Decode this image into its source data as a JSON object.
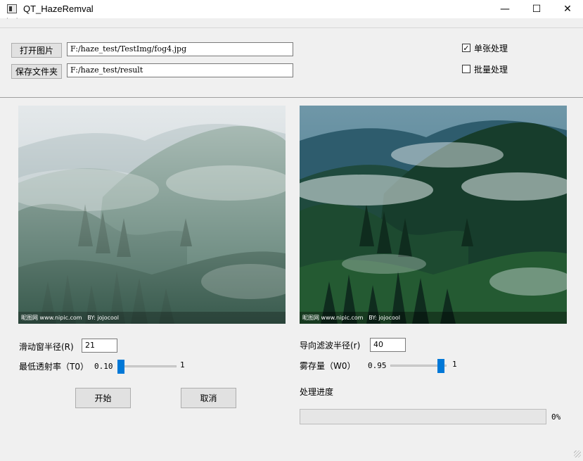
{
  "window": {
    "title": "QT_HazeRemval",
    "minimize_glyph": "—",
    "maximize_glyph": "☐",
    "close_glyph": "✕"
  },
  "menubar": {
    "handle_text": "· ·"
  },
  "file": {
    "open_label": "打开图片",
    "open_path": "F:/haze_test/TestImg/fog4.jpg",
    "save_label": "保存文件夹",
    "save_path": "F:/haze_test/result"
  },
  "mode": {
    "single_label": "单张处理",
    "single_checked": true,
    "batch_label": "批量处理",
    "batch_checked": false,
    "check_glyph": "✓"
  },
  "images": {
    "input_watermark_left": "昵图网 www.nipic.com",
    "input_watermark_mid": "BY: jojocool",
    "output_watermark_left": "昵图网 www.nipic.com",
    "output_watermark_mid": "BY: jojocool"
  },
  "params": {
    "window_radius_label": "滑动窗半径(R)",
    "window_radius_value": "21",
    "min_trans_label": "最低透射率（T0）",
    "min_trans_value": "0.10",
    "min_trans_max": "1",
    "min_trans_fraction": 0.1,
    "guided_radius_label": "导向滤波半径(r)",
    "guided_radius_value": "40",
    "fog_keep_label": "雾存量（W0）",
    "fog_keep_value": "0.95",
    "fog_keep_max": "1",
    "fog_keep_fraction": 0.95
  },
  "actions": {
    "start_label": "开始",
    "cancel_label": "取消"
  },
  "progress": {
    "label": "处理进度",
    "value_text": "0%",
    "fraction": 0
  },
  "colors": {
    "slider_accent": "#0078d7"
  }
}
